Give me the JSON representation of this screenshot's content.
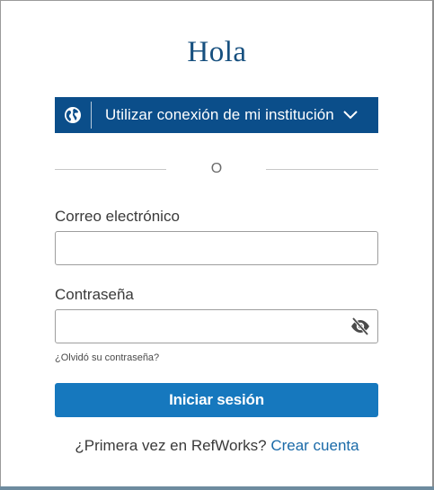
{
  "title": "Hola",
  "sso": {
    "label": "Utilizar conexión de mi institución",
    "icon": "globe-icon",
    "chevron_icon": "chevron-down-icon"
  },
  "divider": {
    "text": "O"
  },
  "email": {
    "label": "Correo electrónico",
    "value": "",
    "placeholder": ""
  },
  "password": {
    "label": "Contraseña",
    "value": "",
    "placeholder": "",
    "toggle_icon": "eye-off-icon"
  },
  "forgot_password": "¿Olvidó su contraseña?",
  "submit_label": "Iniciar sesión",
  "signup": {
    "prompt": "¿Primera vez en RefWorks?",
    "link": "Crear cuenta"
  },
  "colors": {
    "title": "#17507f",
    "sso_background": "#0b4e8a",
    "submit_background": "#1678be",
    "link": "#1a6aa8"
  }
}
